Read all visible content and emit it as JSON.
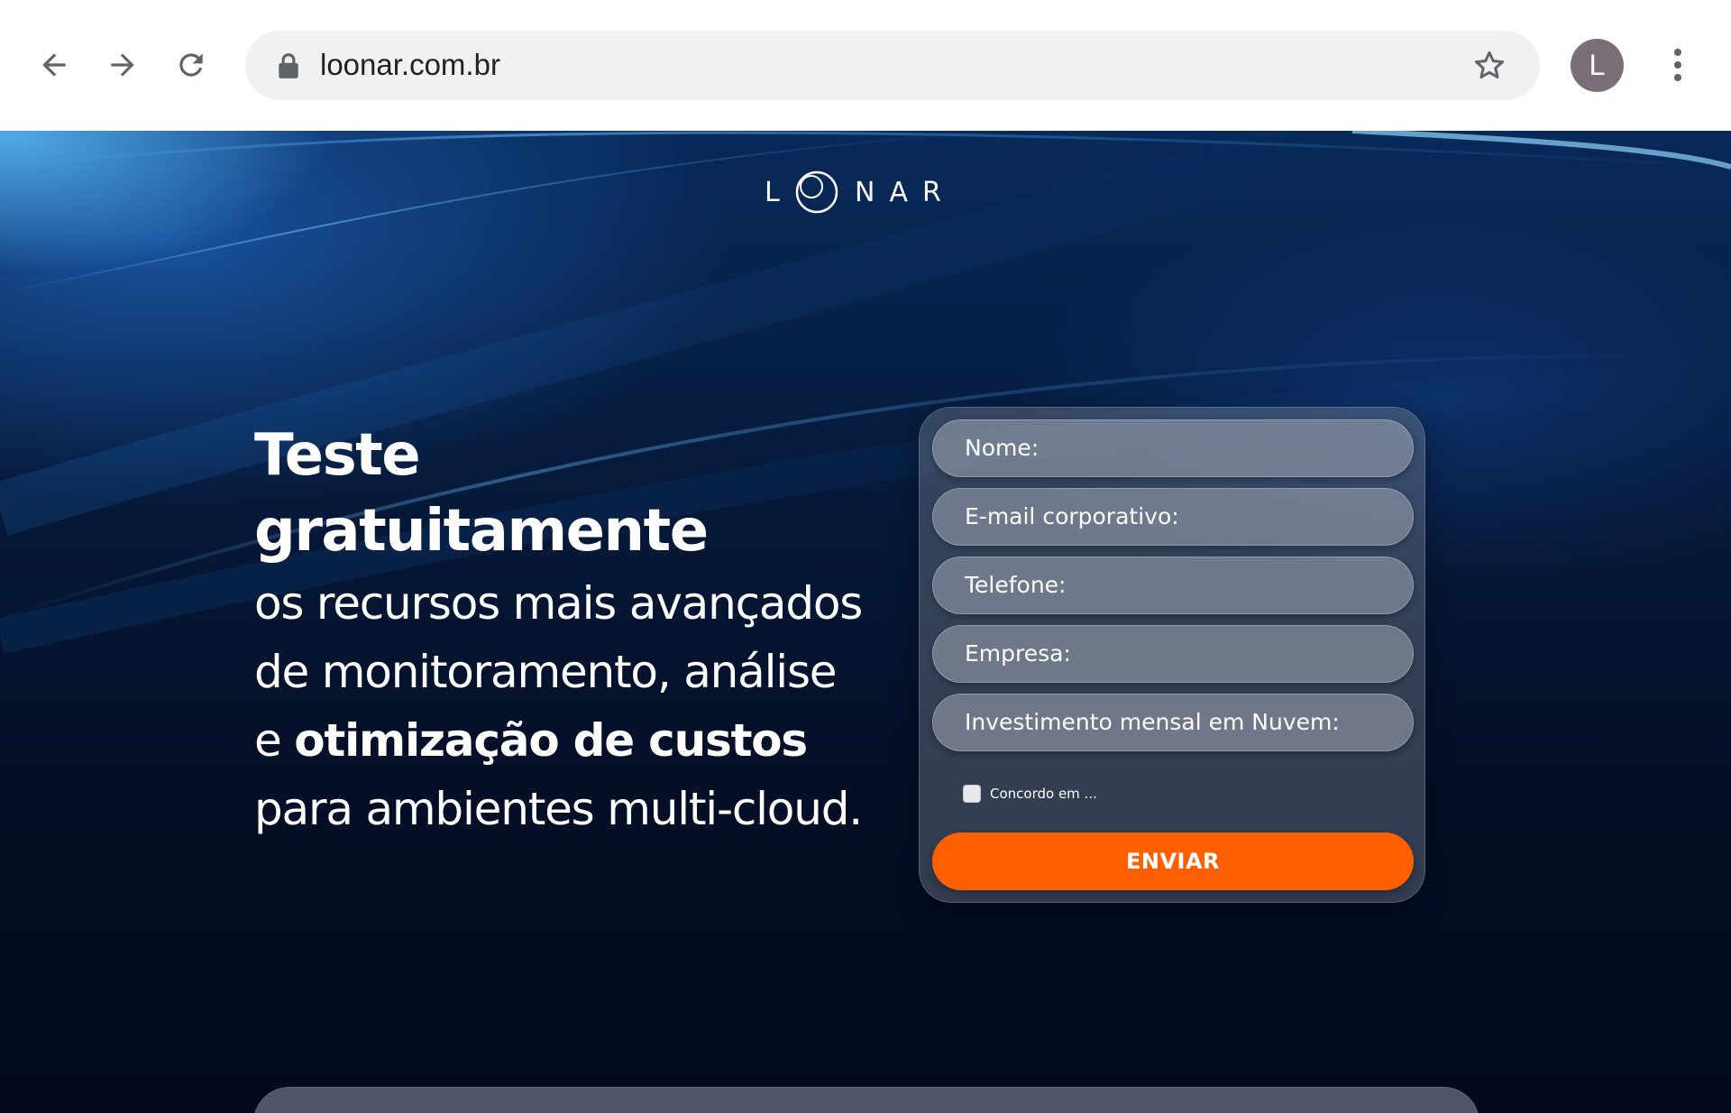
{
  "browser": {
    "url": "loonar.com.br",
    "avatar_letter": "L"
  },
  "icons": {
    "back": "arrow-left-icon",
    "forward": "arrow-right-icon",
    "reload": "reload-icon",
    "lock": "lock-icon",
    "bookmark": "star-icon",
    "menu": "kebab-menu-icon"
  },
  "logo": {
    "text": "LOONAR"
  },
  "hero": {
    "headline": "Teste gratuitamente",
    "line1": "os recursos mais avançados",
    "line2": "de monitoramento, análise",
    "line3_prefix": "e ",
    "line3_bold": "otimização de custos",
    "line4": "para ambientes multi-cloud."
  },
  "form": {
    "fields": [
      {
        "placeholder": "Nome:"
      },
      {
        "placeholder": "E-mail corporativo:"
      },
      {
        "placeholder": "Telefone:"
      },
      {
        "placeholder": "Empresa:"
      },
      {
        "placeholder": "Investimento mensal em Nuvem:"
      }
    ],
    "consent_label": "Concordo em ...",
    "submit_label": "ENVIAR"
  },
  "colors": {
    "accent": "#ff5f00",
    "background_dark": "#040f27",
    "background_blue": "#0a3f8c"
  }
}
